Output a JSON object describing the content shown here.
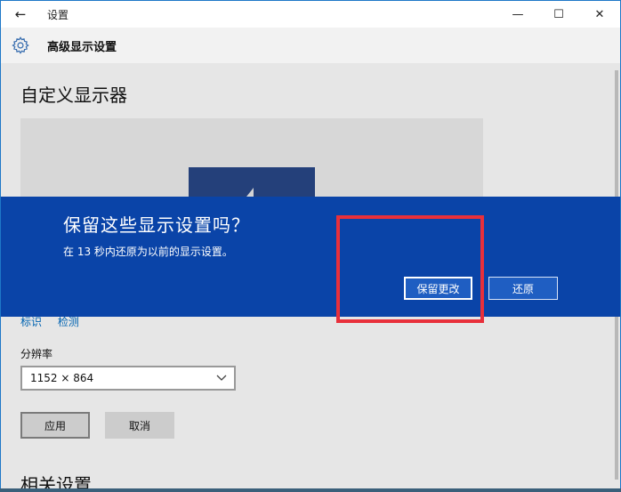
{
  "window": {
    "title": "设置",
    "back_glyph": "←",
    "minimize_glyph": "—",
    "maximize_glyph": "☐",
    "close_glyph": "✕"
  },
  "header": {
    "title": "高级显示设置"
  },
  "main": {
    "title": "自定义显示器",
    "links": [
      "标识",
      "检测"
    ],
    "resolution_label": "分辨率",
    "resolution_value": "1152 × 864",
    "apply_label": "应用",
    "cancel_label": "取消",
    "related_title": "相关设置"
  },
  "dialog": {
    "title": "保留这些显示设置吗？",
    "message": "在 13 秒内还原为以前的显示设置。",
    "keep_label": "保留更改",
    "revert_label": "还原"
  },
  "colors": {
    "dialog_bg": "#0a44a8",
    "highlight": "#e8303b",
    "link": "#0063b1"
  }
}
